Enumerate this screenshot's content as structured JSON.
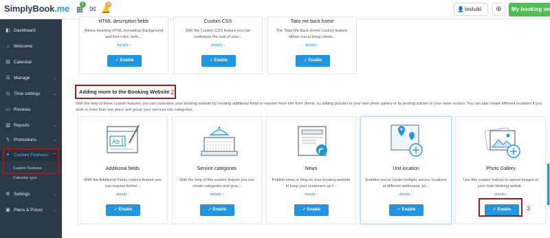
{
  "topbar": {
    "logo_text": "SimplyBook",
    "logo_suffix": ".me",
    "badge_dashboard": "1",
    "badge_notifications": "9",
    "user_name": "testviki",
    "my_site_label": "My booking webs"
  },
  "sidebar": {
    "items": [
      {
        "label": "Dashboard",
        "icon": "dashboard-icon"
      },
      {
        "label": "Welcome",
        "icon": "home-icon"
      },
      {
        "label": "Calendar",
        "icon": "calendar-icon"
      },
      {
        "label": "Manage",
        "icon": "manage-icon"
      },
      {
        "label": "Time settings",
        "icon": "clock-icon"
      },
      {
        "label": "Reviews",
        "icon": "reviews-icon"
      },
      {
        "label": "Reports",
        "icon": "reports-icon"
      },
      {
        "label": "Promotions",
        "icon": "promotions-icon"
      },
      {
        "label": "Custom Features",
        "icon": "puzzle-icon"
      },
      {
        "label": "Settings",
        "icon": "gear-icon"
      },
      {
        "label": "Plans & Prices",
        "icon": "plans-icon"
      }
    ],
    "sub_items": [
      {
        "label": "Custom Features"
      },
      {
        "label": "Calendar sync"
      }
    ]
  },
  "top_cards": [
    {
      "title": "HTML description fields",
      "desc": "Allows inserting HTML formatting (background and font color, bold,...",
      "link": "details",
      "button": "Enable"
    },
    {
      "title": "Custom CSS",
      "desc": "With the Custom CSS feature you can customize the look of your...",
      "link": "details",
      "button": "Enable"
    },
    {
      "title": "Take me back home",
      "desc": "The 'Take Me Back Home' custom feature, allows you to bring clients...",
      "link": "details",
      "button": "Enable"
    }
  ],
  "section": {
    "title": "Adding more to the Booking Website",
    "desc": "With the help of these custom features you can customize your booking website by creating additional fields to request more info from clients, by adding pictures to your own photo gallery or by posting articles to your news section. You can also create different locations if you work in more than one place and group your services into categories."
  },
  "annotations": {
    "n1": "2",
    "n2": "3"
  },
  "cards": [
    {
      "title": "Additional fields",
      "desc": "With the Additional Fields custom feature you can request further...",
      "link": "details",
      "button": "Enable",
      "icon": "additional-fields-icon"
    },
    {
      "title": "Service categories",
      "desc": "With the help of this custom feature you can create categories and grou...",
      "link": "details",
      "button": "Enable",
      "icon": "service-categories-icon"
    },
    {
      "title": "News",
      "desc": "Publish news or blog on your booking website to keep your customers up t...",
      "link": "details",
      "button": "Enable",
      "icon": "news-icon"
    },
    {
      "title": "Unit location",
      "desc": "Enables you to create multiple service locations at different addresses, an...",
      "link": "details",
      "button": "Enable",
      "icon": "unit-location-icon"
    },
    {
      "title": "Photo Gallery",
      "desc": "Use this custom feature to upload images to your main booking websit...",
      "link": "details",
      "button": "Enable",
      "icon": "photo-gallery-icon"
    }
  ],
  "colors": {
    "accent": "#2196e0",
    "sidebar": "#2c3a47",
    "green": "#4cbf52",
    "annotation": "#9b1c1c"
  }
}
